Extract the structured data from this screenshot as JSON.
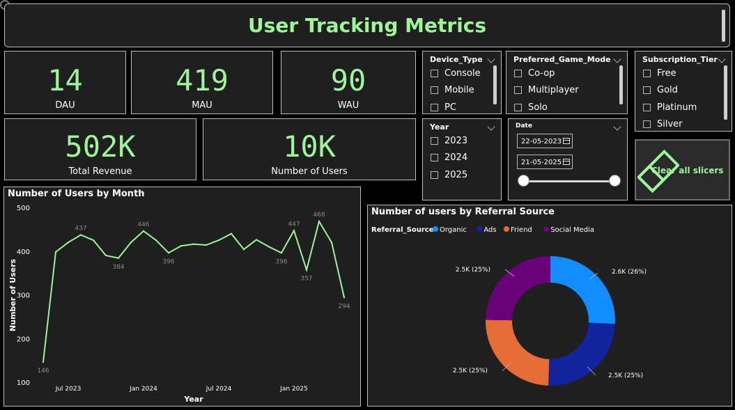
{
  "header": {
    "title": "User Tracking Metrics"
  },
  "kpis": {
    "dau": {
      "value": "14",
      "label": "DAU"
    },
    "mau": {
      "value": "419",
      "label": "MAU"
    },
    "wau": {
      "value": "90",
      "label": "WAU"
    },
    "revenue": {
      "value": "502K",
      "label": "Total Revenue"
    },
    "users": {
      "value": "10K",
      "label": "Number of Users"
    }
  },
  "slicers": {
    "device": {
      "title": "Device_Type",
      "items": [
        "Console",
        "Mobile",
        "PC"
      ]
    },
    "mode": {
      "title": "Preferred_Game_Mode",
      "items": [
        "Co-op",
        "Multiplayer",
        "Solo"
      ]
    },
    "tier": {
      "title": "Subscription_Tier",
      "items": [
        "Free",
        "Gold",
        "Platinum",
        "Silver"
      ]
    },
    "year": {
      "title": "Year",
      "items": [
        "2023",
        "2024",
        "2025"
      ]
    },
    "date": {
      "title": "Date",
      "start": "22-05-2023",
      "end": "21-05-2025"
    }
  },
  "clear_button": {
    "label": "Clear all slicers"
  },
  "icons": {
    "calendar": "calendar-icon",
    "eraser": "eraser-icon",
    "chevron": "chevron-down-icon"
  },
  "colors": {
    "accent": "#9ef59a",
    "organic": "#118dff",
    "ads": "#12239e",
    "friend": "#e66c37",
    "social": "#6b007b"
  },
  "line_chart_meta": {
    "title": "Number of Users by Month"
  },
  "donut_chart_meta": {
    "title": "Number of users by Referral Source",
    "legend_title": "Referral_Source"
  },
  "chart_data": [
    {
      "type": "line",
      "title": "Number of Users by Month",
      "xlabel": "Year",
      "ylabel": "Number of Users",
      "ylim": [
        100,
        500
      ],
      "yticks": [
        100,
        200,
        300,
        400,
        500
      ],
      "xticks": [
        "Jul 2023",
        "Jan 2024",
        "Jul 2024",
        "Jan 2025"
      ],
      "x": [
        "May 2023",
        "Jun 2023",
        "Jul 2023",
        "Aug 2023",
        "Sep 2023",
        "Oct 2023",
        "Nov 2023",
        "Dec 2023",
        "Jan 2024",
        "Feb 2024",
        "Mar 2024",
        "Apr 2024",
        "May 2024",
        "Jun 2024",
        "Jul 2024",
        "Aug 2024",
        "Sep 2024",
        "Oct 2024",
        "Nov 2024",
        "Dec 2024",
        "Jan 2025",
        "Feb 2025",
        "Mar 2025",
        "Apr 2025",
        "May 2025"
      ],
      "series": [
        {
          "values": [
            146,
            398,
            420,
            437,
            425,
            390,
            384,
            420,
            446,
            425,
            396,
            412,
            416,
            414,
            425,
            440,
            404,
            426,
            410,
            396,
            447,
            357,
            468,
            420,
            294
          ]
        }
      ],
      "labeled_points": [
        146,
        437,
        384,
        446,
        396,
        396,
        447,
        357,
        468,
        294
      ],
      "grid": false
    },
    {
      "type": "pie",
      "title": "Number of users by Referral Source",
      "legend_title": "Referral_Source",
      "legend_position": "top-left",
      "categories": [
        "Organic",
        "Ads",
        "Friend",
        "Social Media"
      ],
      "values": [
        2.6,
        2.5,
        2.5,
        2.5
      ],
      "unit": "K",
      "labels": [
        "2.6K (26%)",
        "2.5K (25%)",
        "2.5K (25%)",
        "2.5K (25%)"
      ],
      "donut": true
    }
  ]
}
